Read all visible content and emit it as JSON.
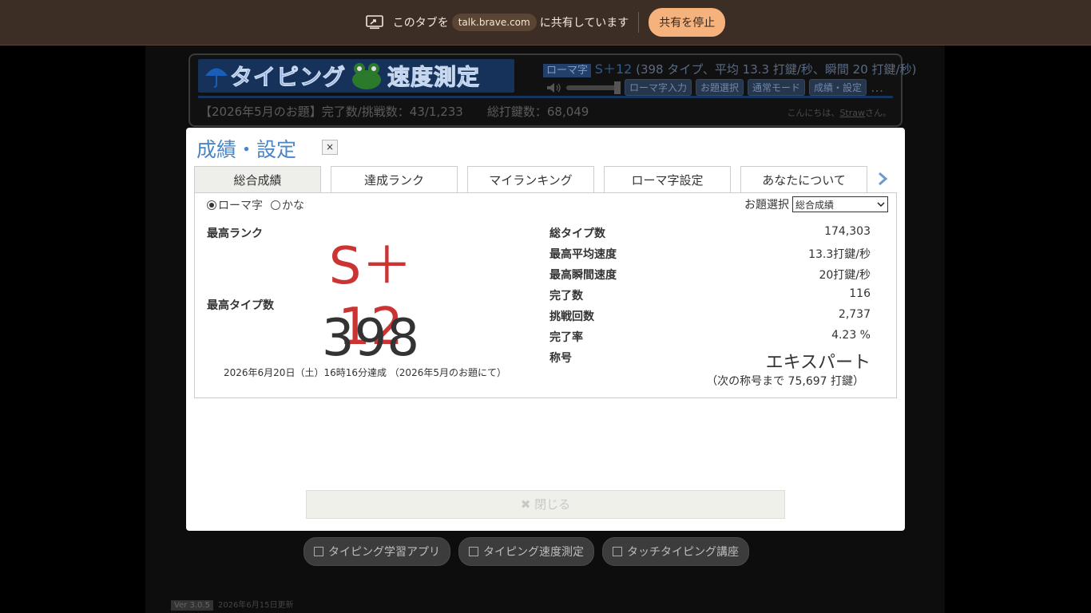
{
  "sharebar": {
    "prefix": "このタブを",
    "site": "talk.brave.com",
    "suffix": "に共有しています",
    "stop_label": "共有を停止"
  },
  "header": {
    "logo_text_1": "タイピング",
    "logo_text_2": "速度測定",
    "romaji_tag": "ローマ字",
    "rank": "S＋12",
    "stats_text": "(398 タイプ、平均 13.3 打鍵/秒、瞬間 20 打鍵/秒)",
    "buttons": [
      "ローマ字入力",
      "お題選択",
      "通常モード",
      "成績・設定"
    ],
    "more": "…",
    "challenge": "【2026年5月のお題】完了数/挑戦数：43/1,233　　総打鍵数：68,049",
    "greeting_pre": "こんにちは、",
    "greeting_user": "Straw",
    "greeting_post": "さん。"
  },
  "modal": {
    "title": "成績・設定",
    "close_x": "×",
    "tabs": [
      "総合成績",
      "達成ランク",
      "マイランキング",
      "ローマ字設定",
      "あなたについて"
    ],
    "mode_options": [
      "ローマ字",
      "かな"
    ],
    "selected_mode": "ローマ字",
    "theme_label": "お題選択",
    "theme_selected": "総合成績",
    "best_rank_label": "最高ランク",
    "best_rank": "S＋12",
    "best_type_label": "最高タイプ数",
    "best_type": "398",
    "achieved_text": "2026年6月20日（土）16時16分達成 （2026年5月のお題にて）",
    "stats": [
      {
        "label": "総タイプ数",
        "value": "174,303"
      },
      {
        "label": "最高平均速度",
        "value": "13.3打鍵/秒"
      },
      {
        "label": "最高瞬間速度",
        "value": "20打鍵/秒"
      },
      {
        "label": "完了数",
        "value": "116"
      },
      {
        "label": "挑戦回数",
        "value": "2,737"
      },
      {
        "label": "完了率",
        "value": "4.23 %"
      },
      {
        "label": "称号",
        "value": ""
      }
    ],
    "title_value": "エキスパート",
    "title_next": "（次の称号まで 75,697 打鍵）",
    "close_button": "✖ 閉じる"
  },
  "footer": {
    "links": [
      "タイピング学習アプリ",
      "タイピング速度測定",
      "タッチタイピング講座"
    ],
    "version": "Ver 3.0.5",
    "updated": "2026年6月15日更新"
  },
  "colors": {
    "accent": "#4a86c6",
    "rank_red": "#cc3333",
    "share_bar": "#3c2e24",
    "stop_button": "#f6b27c"
  }
}
